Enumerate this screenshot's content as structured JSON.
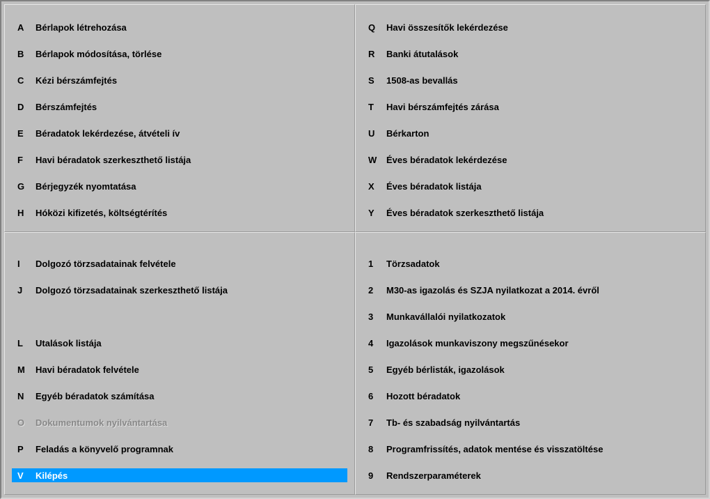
{
  "quadrants": {
    "topLeft": [
      {
        "key": "A",
        "label": "Bérlapok létrehozása",
        "state": "normal"
      },
      {
        "key": "B",
        "label": "Bérlapok módosítása, törlése",
        "state": "normal"
      },
      {
        "key": "C",
        "label": "Kézi bérszámfejtés",
        "state": "normal"
      },
      {
        "key": "D",
        "label": "Bérszámfejtés",
        "state": "normal"
      },
      {
        "key": "E",
        "label": "Béradatok lekérdezése, átvételi ív",
        "state": "normal"
      },
      {
        "key": "F",
        "label": "Havi béradatok szerkeszthető listája",
        "state": "normal"
      },
      {
        "key": "G",
        "label": "Bérjegyzék nyomtatása",
        "state": "normal"
      },
      {
        "key": "H",
        "label": "Hóközi kifizetés, költségtérítés",
        "state": "normal"
      }
    ],
    "topRight": [
      {
        "key": "Q",
        "label": "Havi összesítők lekérdezése",
        "state": "normal"
      },
      {
        "key": "R",
        "label": "Banki átutalások",
        "state": "normal"
      },
      {
        "key": "S",
        "label": "1508-as bevallás",
        "state": "normal"
      },
      {
        "key": "T",
        "label": "Havi bérszámfejtés zárása",
        "state": "normal"
      },
      {
        "key": "U",
        "label": "Bérkarton",
        "state": "normal"
      },
      {
        "key": "W",
        "label": "Éves béradatok lekérdezése",
        "state": "normal"
      },
      {
        "key": "X",
        "label": "Éves béradatok listája",
        "state": "normal"
      },
      {
        "key": "Y",
        "label": "Éves béradatok szerkeszthető listája",
        "state": "normal"
      }
    ],
    "bottomLeft": [
      {
        "key": "I",
        "label": "Dolgozó törzsadatainak felvétele",
        "state": "normal"
      },
      {
        "key": "J",
        "label": "Dolgozó törzsadatainak szerkeszthető listája",
        "state": "normal"
      },
      {
        "key": "",
        "label": "",
        "state": "empty"
      },
      {
        "key": "L",
        "label": "Utalások listája",
        "state": "normal"
      },
      {
        "key": "M",
        "label": "Havi béradatok felvétele",
        "state": "normal"
      },
      {
        "key": "N",
        "label": "Egyéb béradatok számítása",
        "state": "normal"
      },
      {
        "key": "O",
        "label": "Dokumentumok nyilvántartása",
        "state": "disabled"
      },
      {
        "key": "P",
        "label": "Feladás a könyvelő programnak",
        "state": "normal"
      },
      {
        "key": "V",
        "label": "Kilépés",
        "state": "selected"
      }
    ],
    "bottomRight": [
      {
        "key": "1",
        "label": "Törzsadatok",
        "state": "normal"
      },
      {
        "key": "2",
        "label": "M30-as igazolás és SZJA nyilatkozat a 2014. évről",
        "state": "normal"
      },
      {
        "key": "3",
        "label": "Munkavállalói nyilatkozatok",
        "state": "normal"
      },
      {
        "key": "4",
        "label": "Igazolások munkaviszony megszűnésekor",
        "state": "normal"
      },
      {
        "key": "5",
        "label": "Egyéb bérlisták, igazolások",
        "state": "normal"
      },
      {
        "key": "6",
        "label": "Hozott béradatok",
        "state": "normal"
      },
      {
        "key": "7",
        "label": "Tb- és szabadság nyilvántartás",
        "state": "normal"
      },
      {
        "key": "8",
        "label": "Programfrissítés, adatok mentése és visszatöltése",
        "state": "normal"
      },
      {
        "key": "9",
        "label": "Rendszerparaméterek",
        "state": "normal"
      }
    ]
  }
}
